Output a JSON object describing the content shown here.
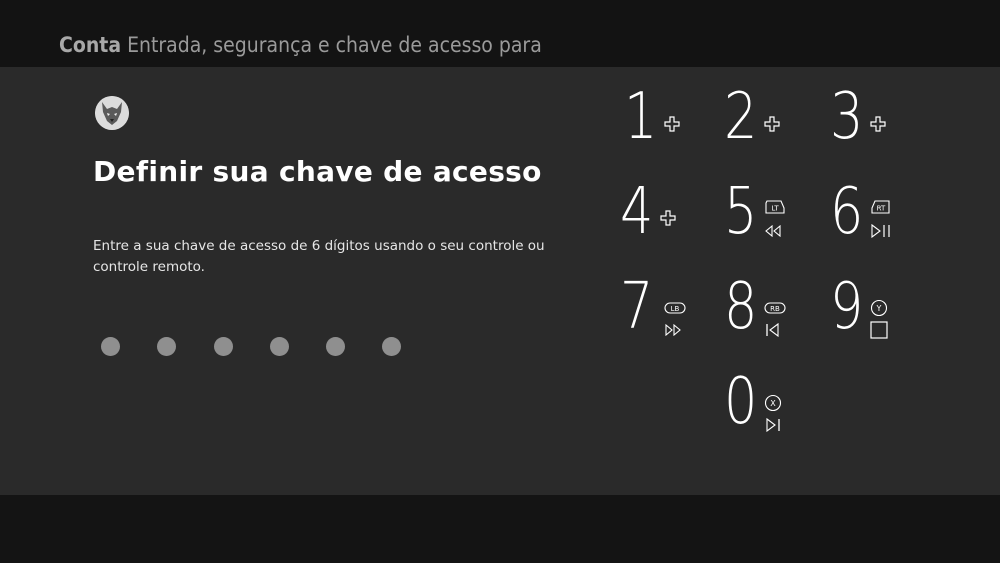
{
  "header": {
    "section": "Conta",
    "path": "Entrada, segurança e chave de acesso para"
  },
  "main": {
    "heading": "Definir sua chave de acesso",
    "description": "Entre a sua chave de acesso de 6 dígitos usando o seu controle ou controle remoto.",
    "passkey_length": 6,
    "digits_entered": 0
  },
  "keypad": {
    "keys": [
      {
        "digit": "1",
        "hints": [
          "dpad-icon"
        ]
      },
      {
        "digit": "2",
        "hints": [
          "dpad-icon"
        ]
      },
      {
        "digit": "3",
        "hints": [
          "dpad-icon"
        ]
      },
      {
        "digit": "4",
        "hints": [
          "dpad-icon"
        ]
      },
      {
        "digit": "5",
        "badge": "LT",
        "hints": [
          "lt-trigger-icon",
          "rewind-icon"
        ]
      },
      {
        "digit": "6",
        "badge": "RT",
        "hints": [
          "rt-trigger-icon",
          "play-pause-icon"
        ]
      },
      {
        "digit": "7",
        "badge": "LB",
        "hints": [
          "lb-bumper-icon",
          "fast-forward-icon"
        ]
      },
      {
        "digit": "8",
        "badge": "RB",
        "hints": [
          "rb-bumper-icon",
          "skip-back-icon"
        ]
      },
      {
        "digit": "9",
        "badge": "Y",
        "hints": [
          "y-button-icon",
          "stop-icon"
        ]
      },
      {
        "digit": "0",
        "badge": "X",
        "hints": [
          "x-button-icon",
          "skip-forward-icon"
        ]
      }
    ]
  },
  "colors": {
    "panel": "#2a2a2a",
    "topbar": "#131313",
    "dot": "#8f8f8f",
    "text": "#ffffff"
  }
}
